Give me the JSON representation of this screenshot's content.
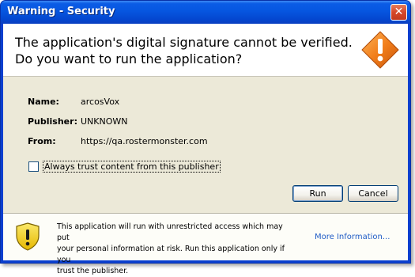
{
  "window": {
    "title": "Warning - Security",
    "close_glyph": "✕"
  },
  "header": {
    "line1": "The application's digital signature cannot be verified.",
    "line2": "Do you want to run the application?",
    "icon": "warning-diamond-icon"
  },
  "fields": [
    {
      "label": "Name:",
      "value": "arcosVox"
    },
    {
      "label": "Publisher:",
      "value": "UNKNOWN"
    },
    {
      "label": "From:",
      "value": "https://qa.rostermonster.com"
    }
  ],
  "trust_checkbox": {
    "label": "Always trust content from this publisher",
    "checked": false
  },
  "buttons": {
    "run": "Run",
    "cancel": "Cancel"
  },
  "footer": {
    "line1": "This application will run with unrestricted access which may put",
    "line2": "your personal information at risk. Run this application only if you",
    "line3": "trust the publisher.",
    "more_info": "More Information...",
    "icon": "warning-shield-icon"
  },
  "colors": {
    "titlebar": "#0656e0",
    "warning_orange": "#f27f1c",
    "shield_yellow": "#f5d21a",
    "link": "#215dc6"
  }
}
